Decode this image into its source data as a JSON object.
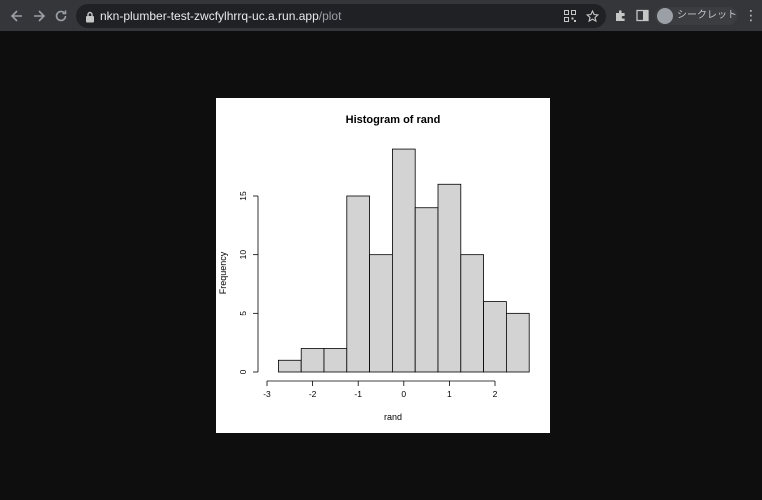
{
  "browser": {
    "url_host": "nkn-plumber-test-zwcfylhrrq-uc.a.run.app",
    "url_path": "/plot",
    "incognito_label": "シークレット",
    "icons": {
      "back": "back-arrow-icon",
      "forward": "forward-arrow-icon",
      "reload": "reload-icon",
      "lock": "lock-icon",
      "qr": "qr-code-icon",
      "bookmark": "star-icon",
      "extensions": "puzzle-icon",
      "side_panel": "side-panel-icon",
      "menu": "kebab-menu-icon"
    }
  },
  "chart_data": {
    "type": "bar",
    "title": "Histogram of rand",
    "xlabel": "rand",
    "ylabel": "Frequency",
    "bin_edges": [
      -2.75,
      -2.25,
      -1.75,
      -1.25,
      -0.75,
      -0.25,
      0.25,
      0.75,
      1.25,
      1.75,
      2.25,
      2.75
    ],
    "bin_start": -2.75,
    "bin_width": 0.5,
    "values": [
      1,
      2,
      2,
      15,
      10,
      19,
      14,
      16,
      10,
      6,
      5
    ],
    "xlim": [
      -3,
      2.5
    ],
    "ylim": [
      0,
      19
    ],
    "x_ticks": [
      -3,
      -2,
      -1,
      0,
      1,
      2
    ],
    "y_ticks": [
      0,
      5,
      10,
      15
    ],
    "bar_fill": "#d3d3d3",
    "bar_stroke": "#000000",
    "grid": false,
    "legend": "none"
  }
}
